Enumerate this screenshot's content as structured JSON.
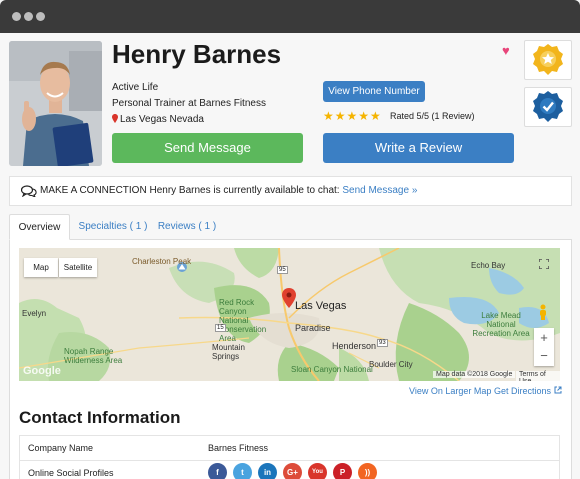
{
  "profile": {
    "name": "Henry Barnes",
    "company_line": "Active Life",
    "title_line": "Personal Trainer at Barnes Fitness",
    "location": "Las Vegas Nevada",
    "send_message": "Send Message",
    "write_review": "Write a Review",
    "view_phone": "View Phone Number",
    "rating_text": "Rated 5/5 (1 Review)",
    "stars": "★★★★★"
  },
  "connect": {
    "prefix": "MAKE A CONNECTION",
    "text": "Henry Barnes is currently available to chat:",
    "link": "Send Message »"
  },
  "tabs": [
    {
      "label": "Overview"
    },
    {
      "label": "Specialties ( 1 )"
    },
    {
      "label": "Reviews ( 1 )"
    }
  ],
  "map": {
    "map_btn": "Map",
    "satellite_btn": "Satellite",
    "labels": {
      "charleston_peak": "Charleston Peak",
      "red_rock": "Red Rock Canyon National Conservation Area",
      "las_vegas": "Las Vegas",
      "paradise": "Paradise",
      "henderson": "Henderson",
      "evelyn": "Evelyn",
      "nopah": "Nopah Range Wilderness Area",
      "mountain_springs": "Mountain Springs",
      "boulder_city": "Boulder City",
      "sloan": "Sloan Canyon National",
      "echo_bay": "Echo Bay",
      "lake_mead": "Lake Mead National Recreation Area",
      "google": "Google",
      "map_data": "Map data ©2018 Google",
      "terms": "Terms of Use",
      "road_15": "15",
      "road_93": "93",
      "road_95": "95"
    },
    "view_larger": "View On Larger Map",
    "get_directions": "Get Directions"
  },
  "contact": {
    "title": "Contact Information",
    "rows": [
      {
        "key": "Company Name",
        "value": "Barnes Fitness"
      },
      {
        "key": "Online Social Profiles",
        "value": ""
      }
    ],
    "social": [
      {
        "icon": "facebook-icon",
        "glyph": "f",
        "color": "#3b5998"
      },
      {
        "icon": "twitter-icon",
        "glyph": "t",
        "color": "#4aa3df"
      },
      {
        "icon": "linkedin-icon",
        "glyph": "in",
        "color": "#1b75bb"
      },
      {
        "icon": "google-plus-icon",
        "glyph": "G+",
        "color": "#dd4b39"
      },
      {
        "icon": "youtube-icon",
        "glyph": "You",
        "color": "#d9352b"
      },
      {
        "icon": "pinterest-icon",
        "glyph": "P",
        "color": "#cb2027"
      },
      {
        "icon": "rss-icon",
        "glyph": "))",
        "color": "#f26522"
      }
    ]
  },
  "colors": {
    "green": "#5cb85c",
    "blue": "#3b7fc4",
    "star": "#f5b400",
    "heart": "#e8457a"
  }
}
